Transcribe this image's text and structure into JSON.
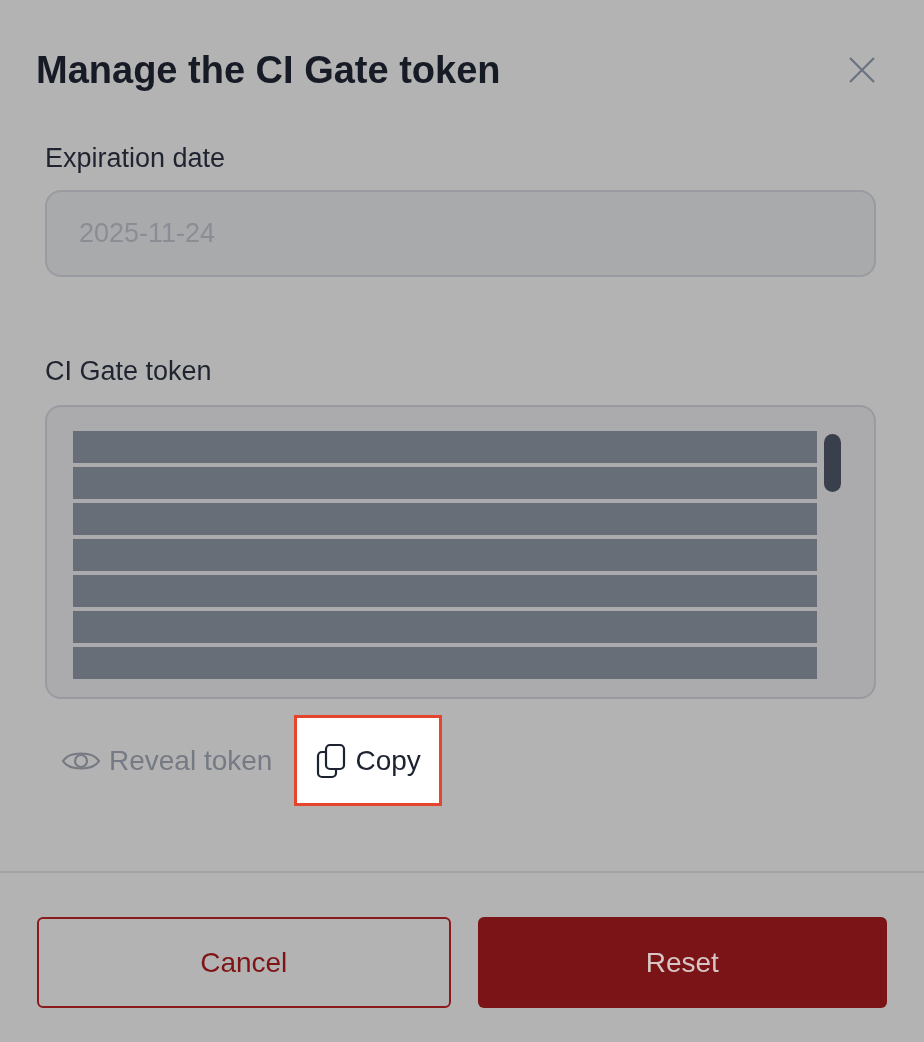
{
  "dialog": {
    "title": "Manage the CI Gate token"
  },
  "expiration": {
    "label": "Expiration date",
    "value": "2025-11-24",
    "disabled": true
  },
  "token": {
    "label": "CI Gate token",
    "masked": true
  },
  "token_actions": [
    {
      "kind": "reveal",
      "label": "Reveal token",
      "disabled": true,
      "highlighted": false
    },
    {
      "kind": "copy",
      "label": "Copy",
      "disabled": false,
      "highlighted": true
    }
  ],
  "buttons": [
    {
      "kind": "secondary",
      "label": "Cancel"
    },
    {
      "kind": "primary",
      "label": "Reset"
    }
  ]
}
